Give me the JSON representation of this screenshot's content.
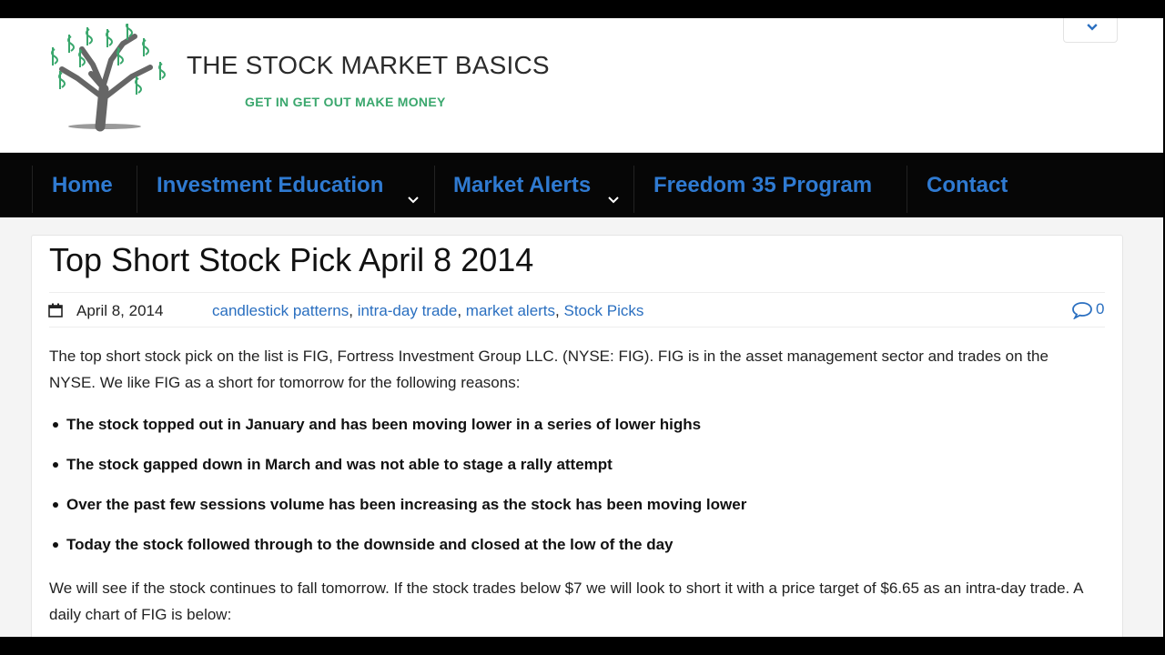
{
  "site": {
    "title": "THE STOCK MARKET BASICS",
    "tagline": "GET IN GET OUT MAKE MONEY"
  },
  "nav": {
    "items": [
      {
        "label": "Home"
      },
      {
        "label": "Investment Education"
      },
      {
        "label": "Market Alerts"
      },
      {
        "label": "Freedom 35 Program"
      },
      {
        "label": "Contact"
      }
    ]
  },
  "post": {
    "title": "Top Short Stock Pick April 8 2014",
    "date": "April 8, 2014",
    "categories": [
      "candlestick patterns",
      "intra-day trade",
      "market alerts",
      "Stock Picks"
    ],
    "comment_count": "0",
    "intro": "The top short stock pick on the list is FIG, Fortress Investment Group LLC.  (NYSE: FIG).  FIG is in the asset management sector and trades on the NYSE.  We like FIG as a short for tomorrow for the following reasons:",
    "bullets": [
      "The stock topped out in January and has been moving lower in a series of lower highs",
      "The stock gapped down in March and was not able to stage a rally attempt",
      "Over the past few sessions volume has been increasing as the stock has been moving lower",
      "Today the stock followed through to the downside and closed at the low of the day"
    ],
    "outro": "We will see if the stock continues to fall tomorrow.  If the stock trades below $7 we will look to short it with a price target of $6.65 as an intra-day trade.  A daily chart of FIG is below:"
  },
  "colors": {
    "link": "#2a6fc0",
    "nav_text": "#2f7ad1",
    "nav_bg": "#060606",
    "tagline": "#3aa76d"
  }
}
